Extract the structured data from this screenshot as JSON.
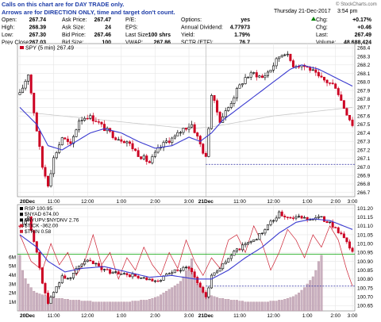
{
  "note": {
    "line1": "Calls on this chart are for DAY TRADE only.",
    "line2": "Arrows are for DIRECTION ONLY, time and target don't count."
  },
  "header": {
    "date": "Thursday 21-Dec-2017",
    "time": "3:54 pm",
    "watermark": "© StockCharts.com",
    "quote": [
      [
        {
          "l": "Open:",
          "v": "267.74"
        },
        {
          "l": "Ask Price:",
          "v": "267.47"
        },
        {
          "l": "P/E:",
          "v": ""
        },
        {
          "l": "Options:",
          "v": "yes"
        }
      ],
      [
        {
          "l": "High:",
          "v": "268.39"
        },
        {
          "l": "Ask Size:",
          "v": "24"
        },
        {
          "l": "EPS:",
          "v": ""
        },
        {
          "l": "Annual Dividend:",
          "v": "4.77973"
        }
      ],
      [
        {
          "l": "Low:",
          "v": "267.30"
        },
        {
          "l": "Bid Price:",
          "v": "267.46"
        },
        {
          "l": "Last Size:",
          "v": "100 shrs"
        },
        {
          "l": "Yield:",
          "v": "1.79%"
        }
      ],
      [
        {
          "l": "Prev Close:",
          "v": "267.03"
        },
        {
          "l": "Bid Size:",
          "v": "100"
        },
        {
          "l": "VWAP:",
          "v": "267.86"
        },
        {
          "l": "SCTR (ETF):",
          "v": "76.7"
        }
      ]
    ],
    "summary": [
      {
        "l": "Chg:",
        "v": "+0.17%"
      },
      {
        "l": "Chg:",
        "v": "+0.46"
      },
      {
        "l": "Last:",
        "v": "267.49"
      },
      {
        "l": "Volume:",
        "v": "48,688,424"
      }
    ]
  },
  "colors": {
    "up": "#000000",
    "down": "#cc0022",
    "ma": "#3b3bd0",
    "ma_long": "#c8c8c8",
    "ref": "#2a2aa0",
    "volume": "#c8b0c0",
    "rsp_line": "#cc2233",
    "green": "#00a000"
  },
  "chart_data": [
    {
      "type": "candlestick",
      "title": "SPY (5 min) 267.49",
      "legend": "SPY (5 min) 267.49",
      "x_ticks": [
        "20Dec",
        "11:00",
        "12:00",
        "1:00",
        "2:00",
        "3:00",
        "21Dec",
        "11:00",
        "12:00",
        "1:00",
        "2:00",
        "3:00"
      ],
      "y_ticks": [
        "266.7",
        "266.8",
        "266.9",
        "267.0",
        "267.1",
        "267.2",
        "267.3",
        "267.4",
        "267.5",
        "267.6",
        "267.7",
        "267.8",
        "267.9",
        "268.0",
        "268.1",
        "268.2",
        "268.3",
        "268.4"
      ],
      "ylim": [
        266.65,
        268.45
      ],
      "reference_line": 267.03,
      "close_path": [
        [
          0,
          267.85
        ],
        [
          3,
          268.1
        ],
        [
          5,
          267.65
        ],
        [
          8,
          267.0
        ],
        [
          10,
          266.8
        ],
        [
          12,
          267.1
        ],
        [
          15,
          267.35
        ],
        [
          18,
          267.25
        ],
        [
          21,
          267.55
        ],
        [
          24,
          267.6
        ],
        [
          27,
          267.55
        ],
        [
          30,
          267.45
        ],
        [
          34,
          267.35
        ],
        [
          38,
          267.3
        ],
        [
          42,
          267.15
        ],
        [
          46,
          267.05
        ],
        [
          49,
          267.2
        ],
        [
          52,
          267.3
        ],
        [
          55,
          267.35
        ],
        [
          58,
          267.45
        ],
        [
          61,
          267.5
        ],
        [
          63,
          267.35
        ],
        [
          66,
          267.1
        ],
        [
          68,
          267.85
        ],
        [
          71,
          267.55
        ],
        [
          74,
          267.7
        ],
        [
          77,
          267.9
        ],
        [
          80,
          268.05
        ],
        [
          83,
          268.1
        ],
        [
          86,
          268.05
        ],
        [
          89,
          268.15
        ],
        [
          92,
          268.3
        ],
        [
          94,
          268.35
        ],
        [
          97,
          268.2
        ],
        [
          100,
          268.2
        ],
        [
          103,
          268.15
        ],
        [
          106,
          268.05
        ],
        [
          109,
          268.0
        ],
        [
          112,
          267.95
        ],
        [
          115,
          267.7
        ],
        [
          118,
          267.5
        ]
      ],
      "ma_path": [
        [
          0,
          267.7
        ],
        [
          6,
          267.5
        ],
        [
          10,
          267.25
        ],
        [
          15,
          267.2
        ],
        [
          20,
          267.3
        ],
        [
          25,
          267.4
        ],
        [
          30,
          267.45
        ],
        [
          36,
          267.4
        ],
        [
          42,
          267.3
        ],
        [
          48,
          267.22
        ],
        [
          54,
          267.25
        ],
        [
          60,
          267.35
        ],
        [
          64,
          267.3
        ],
        [
          68,
          267.4
        ],
        [
          72,
          267.55
        ],
        [
          78,
          267.7
        ],
        [
          84,
          267.85
        ],
        [
          90,
          268.0
        ],
        [
          96,
          268.15
        ],
        [
          100,
          268.2
        ],
        [
          106,
          268.15
        ],
        [
          112,
          268.05
        ],
        [
          118,
          267.95
        ]
      ],
      "ma_long_path": [
        [
          0,
          267.65
        ],
        [
          30,
          267.55
        ],
        [
          60,
          267.45
        ],
        [
          68,
          267.47
        ],
        [
          90,
          267.6
        ],
        [
          118,
          267.7
        ]
      ]
    },
    {
      "type": "line",
      "legend": [
        "RSP 100.95",
        "$NYAD 674.00",
        "$NYUPV:$NYDNV 2.76",
        "$TICK -362.00",
        "$TRIN 0.58"
      ],
      "x_ticks": [
        "20Dec",
        "11:00",
        "12:00",
        "1:00",
        "2:00",
        "3:00",
        "21Dec",
        "11:00",
        "12:00",
        "1:00",
        "2:00",
        "3:00"
      ],
      "y_ticks": [
        "100.65",
        "100.70",
        "100.75",
        "100.80",
        "100.85",
        "100.90",
        "100.95",
        "101.00",
        "101.05",
        "101.10",
        "101.15",
        "101.20"
      ],
      "ylim": [
        100.62,
        101.22
      ],
      "volume_ticks": [
        "1M",
        "2M",
        "3M",
        "4M",
        "5M",
        "6M"
      ],
      "green_line": 100.94,
      "dotted_line": 100.76,
      "price_path": [
        [
          0,
          101.1
        ],
        [
          3,
          101.15
        ],
        [
          6,
          100.95
        ],
        [
          8,
          100.78
        ],
        [
          10,
          100.66
        ],
        [
          12,
          100.72
        ],
        [
          15,
          100.82
        ],
        [
          18,
          100.8
        ],
        [
          21,
          100.88
        ],
        [
          24,
          100.9
        ],
        [
          27,
          100.88
        ],
        [
          30,
          100.85
        ],
        [
          35,
          100.83
        ],
        [
          40,
          100.82
        ],
        [
          44,
          100.8
        ],
        [
          48,
          100.78
        ],
        [
          52,
          100.82
        ],
        [
          56,
          100.85
        ],
        [
          60,
          100.87
        ],
        [
          63,
          100.78
        ],
        [
          66,
          100.7
        ],
        [
          68,
          100.82
        ],
        [
          72,
          100.88
        ],
        [
          76,
          100.95
        ],
        [
          80,
          101.0
        ],
        [
          84,
          101.03
        ],
        [
          88,
          101.1
        ],
        [
          92,
          101.17
        ],
        [
          95,
          101.15
        ],
        [
          98,
          101.15
        ],
        [
          102,
          101.14
        ],
        [
          106,
          101.15
        ],
        [
          110,
          101.12
        ],
        [
          114,
          101.05
        ],
        [
          118,
          100.95
        ]
      ],
      "ma_path": [
        [
          0,
          101.05
        ],
        [
          6,
          100.98
        ],
        [
          10,
          100.9
        ],
        [
          16,
          100.84
        ],
        [
          22,
          100.86
        ],
        [
          30,
          100.87
        ],
        [
          38,
          100.84
        ],
        [
          46,
          100.81
        ],
        [
          54,
          100.82
        ],
        [
          62,
          100.8
        ],
        [
          68,
          100.8
        ],
        [
          74,
          100.85
        ],
        [
          80,
          100.92
        ],
        [
          86,
          100.98
        ],
        [
          92,
          101.06
        ],
        [
          98,
          101.12
        ],
        [
          104,
          101.14
        ],
        [
          110,
          101.13
        ],
        [
          118,
          101.08
        ]
      ],
      "rsp_line_path": [
        [
          0,
          101.05
        ],
        [
          4,
          100.9
        ],
        [
          8,
          100.85
        ],
        [
          11,
          101.0
        ],
        [
          14,
          100.88
        ],
        [
          17,
          100.95
        ],
        [
          20,
          100.82
        ],
        [
          23,
          100.9
        ],
        [
          26,
          101.05
        ],
        [
          29,
          100.88
        ],
        [
          32,
          100.95
        ],
        [
          35,
          100.8
        ],
        [
          38,
          100.92
        ],
        [
          41,
          100.85
        ],
        [
          44,
          100.98
        ],
        [
          47,
          100.88
        ],
        [
          50,
          100.82
        ],
        [
          53,
          100.95
        ],
        [
          56,
          100.86
        ],
        [
          59,
          101.02
        ],
        [
          62,
          100.9
        ],
        [
          65,
          100.82
        ],
        [
          68,
          100.92
        ],
        [
          71,
          100.86
        ],
        [
          74,
          101.02
        ],
        [
          77,
          101.05
        ],
        [
          80,
          100.95
        ],
        [
          83,
          101.1
        ],
        [
          86,
          101.0
        ],
        [
          89,
          100.85
        ],
        [
          92,
          100.95
        ],
        [
          95,
          101.08
        ],
        [
          98,
          101.02
        ],
        [
          101,
          100.92
        ],
        [
          104,
          101.05
        ],
        [
          107,
          100.98
        ],
        [
          110,
          101.1
        ],
        [
          113,
          101.02
        ],
        [
          116,
          100.85
        ],
        [
          118,
          100.76
        ]
      ],
      "volume_profile": [
        6.2,
        4.5,
        3.6,
        3.0,
        2.6,
        2.2,
        2.0,
        1.9,
        1.8,
        1.7,
        1.6,
        1.6,
        1.5,
        1.4,
        1.4,
        1.4,
        1.3,
        1.3,
        1.2,
        1.2,
        1.2,
        1.2,
        1.1,
        1.1,
        1.1,
        1.1,
        1.0,
        1.0,
        1.0,
        1.0,
        1.0,
        1.0,
        1.0,
        1.0,
        1.0,
        1.0,
        1.0,
        1.0,
        1.0,
        1.0,
        1.1,
        1.1,
        1.1,
        1.2,
        1.2,
        1.2,
        1.3,
        1.4,
        1.5,
        1.6,
        1.8,
        2.0,
        2.2,
        2.4,
        2.6,
        2.8,
        3.0,
        3.3,
        3.8,
        4.5,
        5.0,
        5.8,
        3.8,
        3.0,
        2.6,
        2.3,
        2.0,
        1.8,
        1.7,
        1.6,
        1.5,
        1.4,
        1.4,
        1.3,
        1.3,
        1.2,
        1.2,
        1.2,
        1.1,
        1.1,
        1.0,
        1.0,
        1.0,
        1.0,
        1.0,
        1.0,
        1.0,
        1.0,
        1.0,
        1.1,
        1.1,
        1.1,
        1.2,
        1.2,
        1.3,
        1.4,
        1.5,
        1.6,
        1.8,
        2.0,
        2.3,
        2.6,
        3.0,
        3.4,
        3.8,
        4.5,
        5.5,
        6.2
      ]
    }
  ]
}
